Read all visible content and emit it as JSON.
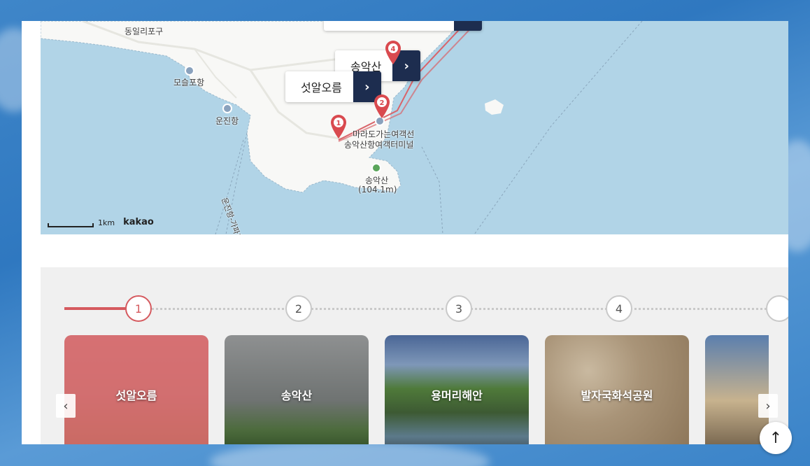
{
  "map": {
    "labels": {
      "dongil": "동일리포구",
      "moseul": "모슬포항",
      "unjin": "운진항",
      "ferry1": "마라도가는여객선",
      "ferry2": "송악산항여객터미널",
      "mountain": "송악산",
      "mountain_height": "(104.1m)",
      "route": "운진항-가파도"
    },
    "callouts": [
      {
        "name": "송악산",
        "button_icon": "chevron-right-icon"
      },
      {
        "name": "섯알오름",
        "button_icon": "chevron-right-icon"
      }
    ],
    "pins": [
      "1",
      "2",
      "4"
    ],
    "scale_label": "1km",
    "brand": "kakao",
    "colors": {
      "sea": "#b1d4e7",
      "land": "#f8f8f6",
      "pin": "#d94a4f",
      "route": "#d9646a",
      "callout_btn": "#1d2d4f"
    }
  },
  "course": {
    "steps": [
      "1",
      "2",
      "3",
      "4"
    ],
    "active_step": "1",
    "cards": [
      {
        "title": "섯알오름"
      },
      {
        "title": "송악산"
      },
      {
        "title": "용머리해안"
      },
      {
        "title": "발자국화석공원"
      }
    ],
    "prev_icon": "chevron-left-icon",
    "next_icon": "chevron-right-icon",
    "accent": "#d55a5f"
  },
  "scroll_top": {
    "icon": "arrow-up-icon"
  }
}
